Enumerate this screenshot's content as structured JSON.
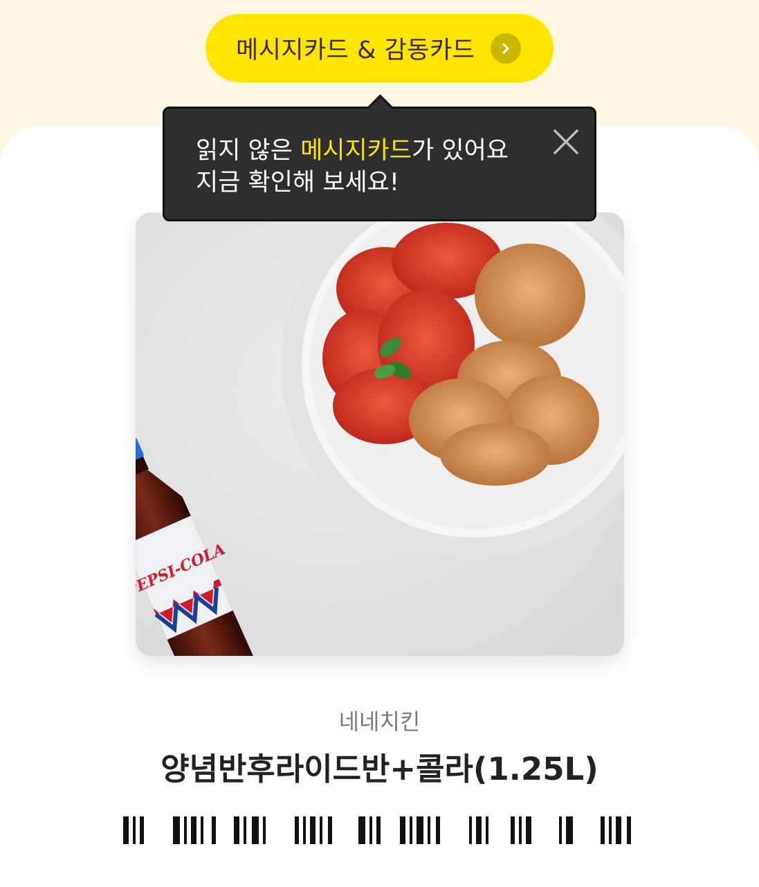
{
  "header": {
    "button_label": "메시지카드 & 감동카드",
    "button_icon": "chevron-right-icon"
  },
  "tooltip": {
    "line1_prefix": "읽지 않은 ",
    "line1_highlight": "메시지카드",
    "line1_suffix": "가 있어요",
    "line2": "지금 확인해 보세요!",
    "close_icon": "close-icon"
  },
  "product": {
    "image_alt": "chicken and cola bottle",
    "bottle_label": "PEPSI-COLA",
    "brand": "네네치킨",
    "name": "양념반후라이드반+콜라(1.25L)"
  },
  "colors": {
    "page_bg": "#fdf7e1",
    "accent_yellow": "#fee500",
    "tooltip_bg": "#2e2e2e"
  }
}
